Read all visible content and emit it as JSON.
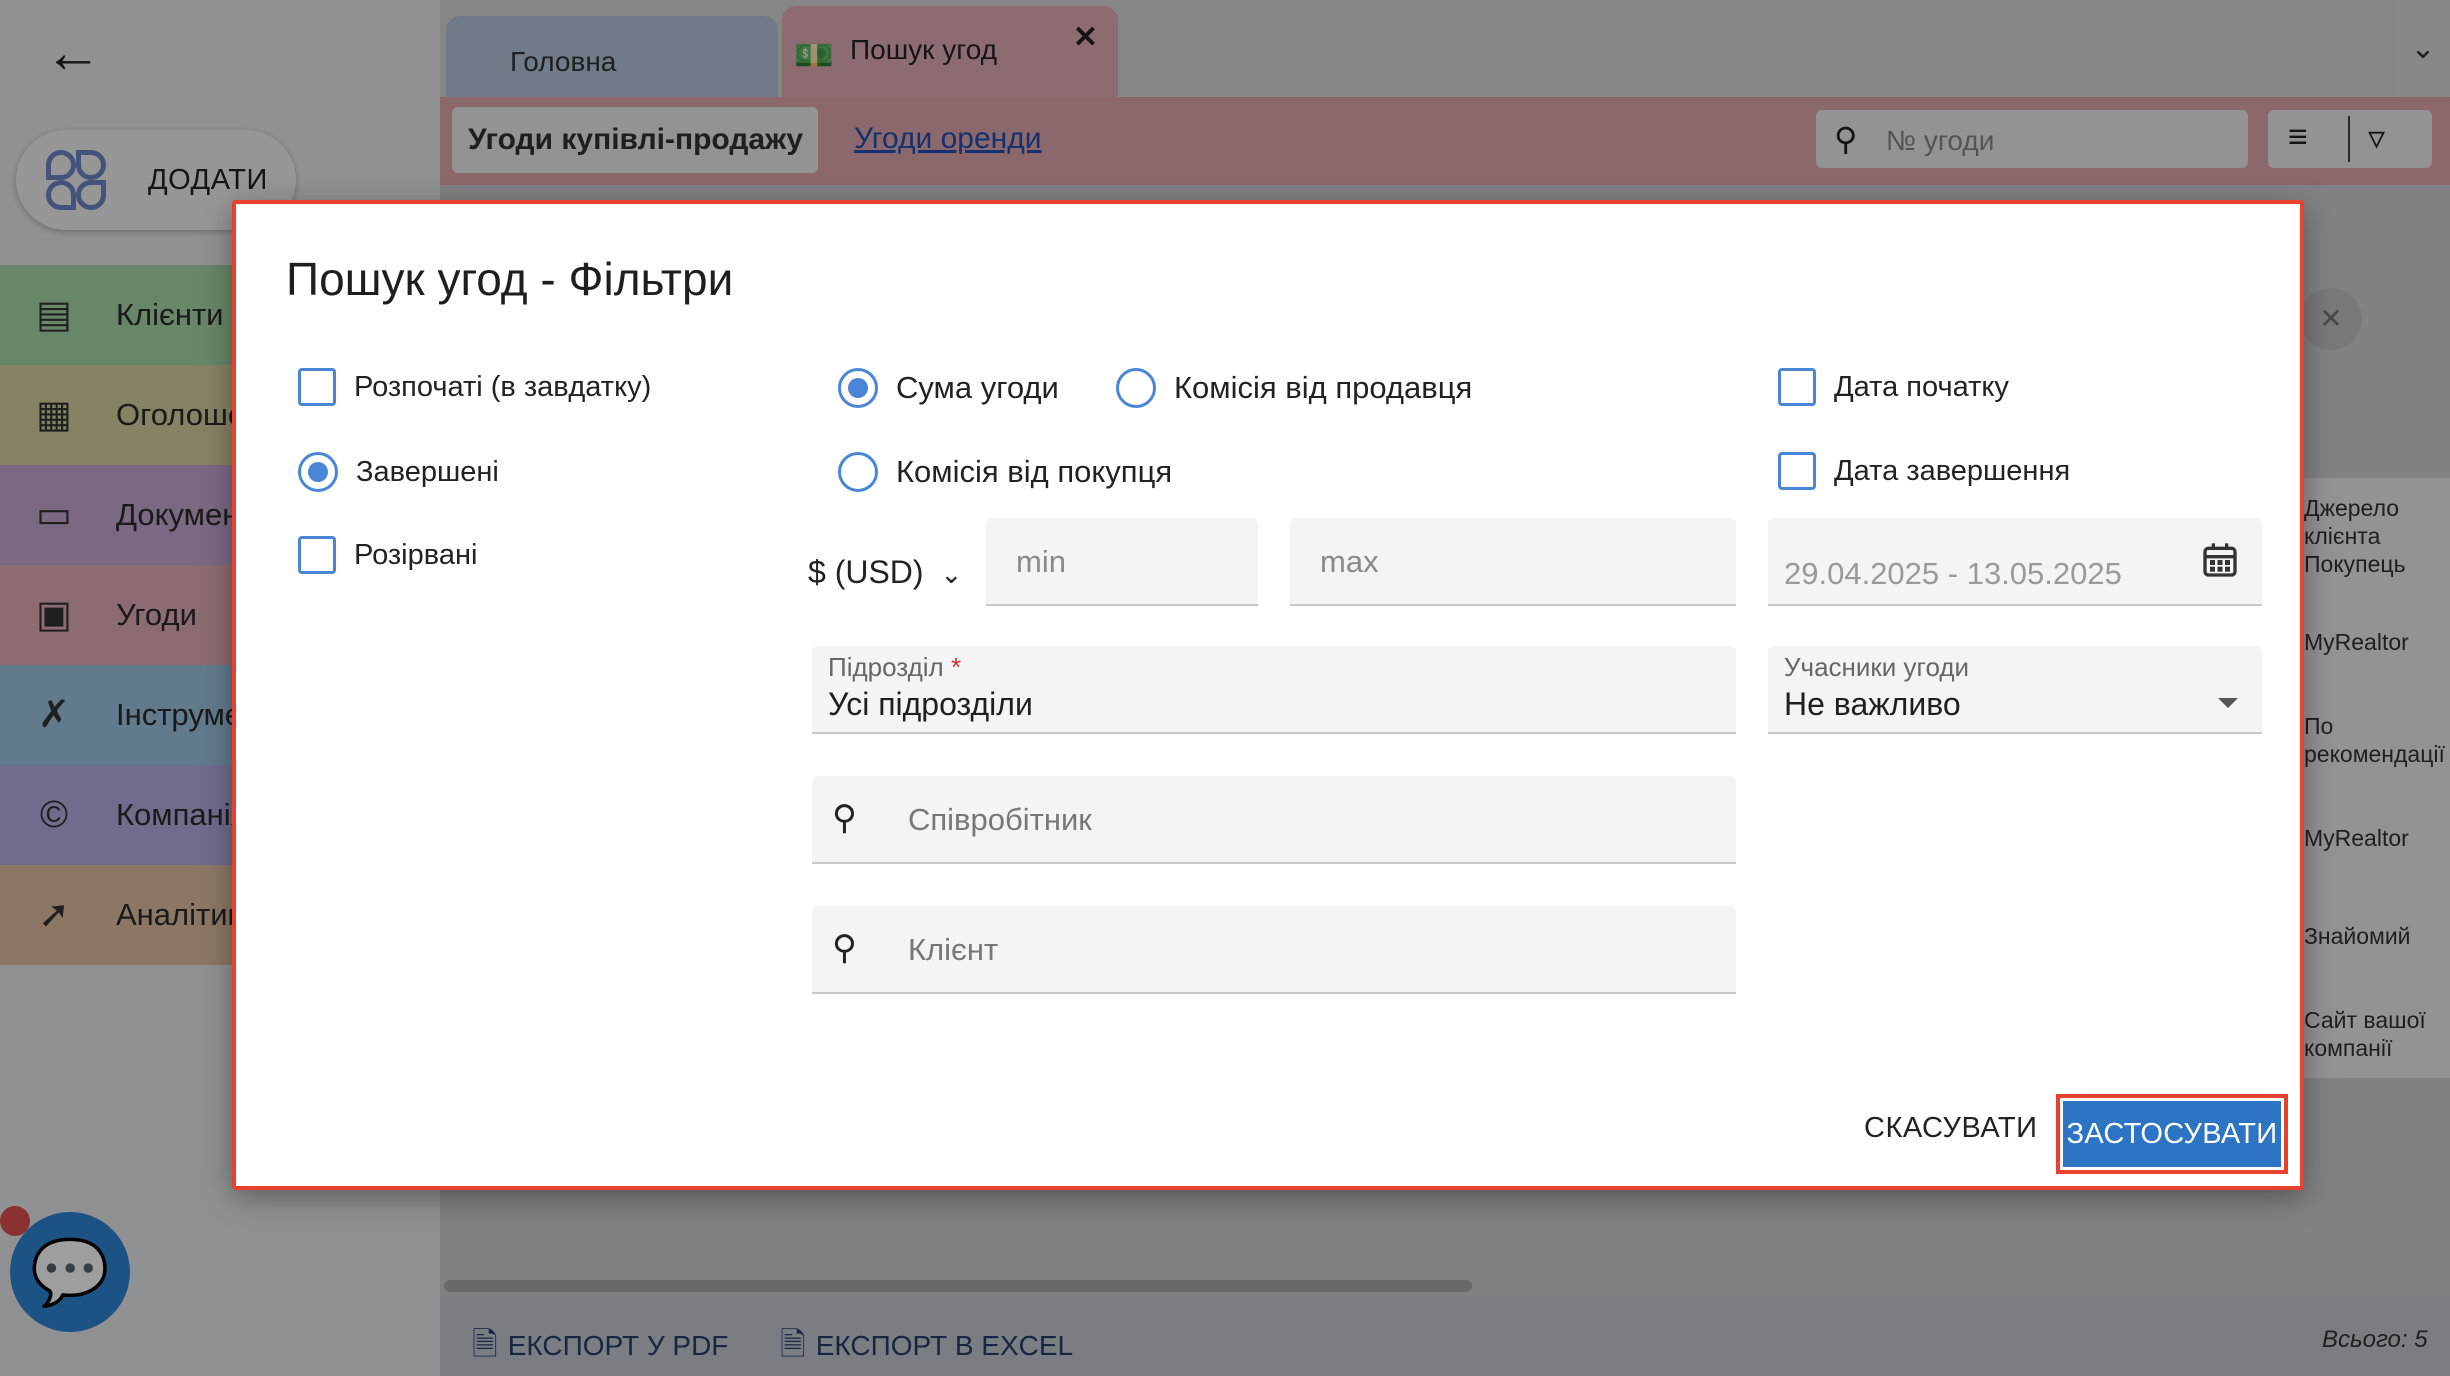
{
  "sidebar": {
    "add_label": "ДОДАТИ",
    "items": [
      {
        "label": "Клієнти",
        "color": "#a8d8a8",
        "icon": "contacts-icon"
      },
      {
        "label": "Оголошен",
        "color": "#d9d2a2",
        "icon": "listings-icon"
      },
      {
        "label": "Докумен",
        "color": "#c7a9d4",
        "icon": "folder-icon"
      },
      {
        "label": "Угоди",
        "color": "#e3aeb5",
        "icon": "deals-icon"
      },
      {
        "label": "Інструме",
        "color": "#9ec7e3",
        "icon": "tools-icon"
      },
      {
        "label": "Компанія",
        "color": "#b4aee3",
        "icon": "copyright-icon"
      },
      {
        "label": "Аналітик",
        "color": "#e3c1a2",
        "icon": "analytics-icon"
      }
    ]
  },
  "tabs": {
    "home": "Головна",
    "deals_search": "Пошук угод"
  },
  "subtabs": {
    "sale": "Угоди купівлі-продажу",
    "rent": "Угоди оренди"
  },
  "top_search": {
    "placeholder": "№ угоди"
  },
  "right_column": {
    "header": [
      "Джерело",
      "клієнта",
      "Покупець"
    ],
    "rows": [
      "MyRealtor",
      "По рекомендації",
      "MyRealtor",
      "Знайомий",
      "Сайт вашої компанії"
    ]
  },
  "bottom": {
    "export_pdf": "ЕКСПОРТ У PDF",
    "export_excel": "ЕКСПОРТ В EXCEL",
    "total": "Всього: 5"
  },
  "dialog": {
    "title": "Пошук угод - Фільтри",
    "status": {
      "started": "Розпочаті (в завдатку)",
      "completed": "Завершені",
      "terminated": "Розірвані"
    },
    "amount_type": {
      "deal_sum": "Сума угоди",
      "seller_commission": "Комісія від продавця",
      "buyer_commission": "Комісія від покупця"
    },
    "dates": {
      "start_date": "Дата початку",
      "end_date": "Дата завершення",
      "range": "29.04.2025 - 13.05.2025"
    },
    "currency": "$ (USD)",
    "min_placeholder": "min",
    "max_placeholder": "max",
    "division": {
      "label": "Підрозділ",
      "required": "*",
      "value": "Усі підрозділи"
    },
    "participants": {
      "label": "Учасники угоди",
      "value": "Не важливо"
    },
    "employee_placeholder": "Співробітник",
    "client_placeholder": "Клієнт",
    "cancel": "СКАСУВАТИ",
    "apply": "ЗАСТОСУВАТИ"
  }
}
